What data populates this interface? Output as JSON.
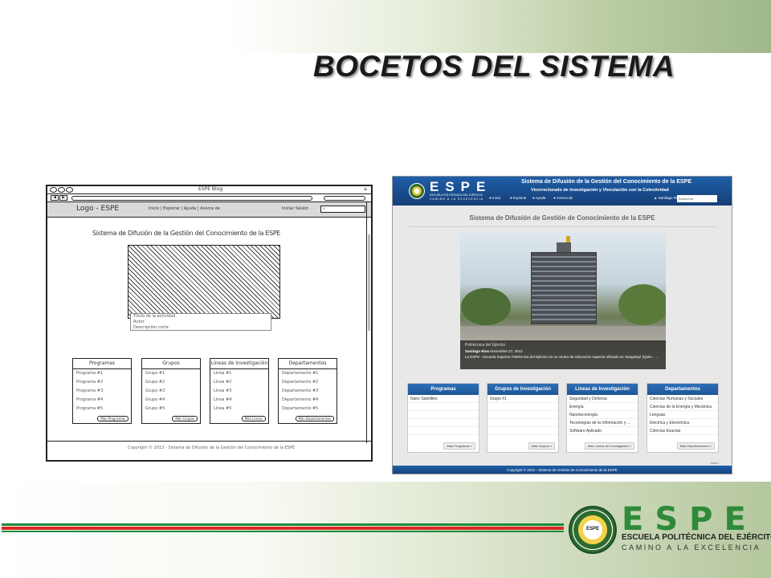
{
  "slide": {
    "title": "BOCETOS DEL SISTEMA",
    "colors": {
      "green": "#1c8a3c",
      "red": "#d62a22",
      "band_green": "#9fb889"
    },
    "logo": {
      "seal_text": "ESPE",
      "word": "ESPE",
      "line1": "ESCUELA POLITÉCNICA DEL EJÉRCITO",
      "line2": "CAMINO A LA EXCELENCIA"
    }
  },
  "sketch": {
    "window_title": "ESPE Blog",
    "close_glyph": "+",
    "logo": "Logo - ESPE",
    "nav": "Inicio | Explorar | Ayuda | Acerca de",
    "login": "Iniciar Sesión",
    "search_icon": "search-icon",
    "heading": "Sistema de Difusión de la Gestión del Conocimiento de la ESPE",
    "caption_lines": [
      "Título de la actividad",
      "Autor",
      "Descripción corta"
    ],
    "panels": [
      {
        "title": "Programas",
        "items": [
          "Programa #1",
          "Programa #2",
          "Programa #3",
          "Programa #4",
          "Programa #5"
        ],
        "more": "Más Programas"
      },
      {
        "title": "Grupos",
        "items": [
          "Grupo #1",
          "Grupo #2",
          "Grupo #3",
          "Grupo #4",
          "Grupo #5"
        ],
        "more": "Más Grupos"
      },
      {
        "title": "Líneas de Investigación",
        "items": [
          "Línea #1",
          "Línea #2",
          "Línea #3",
          "Línea #4",
          "Línea #5"
        ],
        "more": "Más Líneas"
      },
      {
        "title": "Departamentos",
        "items": [
          "Departamento #1",
          "Departamento #2",
          "Departamento #3",
          "Departamento #4",
          "Departamento #5"
        ],
        "more": "Más Departamentos"
      }
    ],
    "footer": "Copyright © 2013 - Sistema de Difusión de la Gestión del Conocimiento de la ESPE"
  },
  "real": {
    "brand": "ESPE",
    "brand_sub1": "ESCUELA POLITÉCNICA DEL EJÉRCITO",
    "brand_sub2": "CAMINO A LA EXCELENCIA",
    "header_title": "Sistema de Difusión de la Gestión del Conocimiento de la ESPE",
    "header_subtitle": "Vicerrectorado de Investigación y Vinculación con la Colectividad",
    "nav": [
      {
        "label": "Inicio",
        "icon": "home-icon"
      },
      {
        "label": "Explorar",
        "icon": "compass-icon"
      },
      {
        "label": "Ayuda",
        "icon": "help-icon"
      },
      {
        "label": "Acerca de",
        "icon": "info-icon"
      }
    ],
    "user": "Santiago Rios",
    "user_icon": "user-icon",
    "search_placeholder": "Búsqueda",
    "page_title": "Sistema de Difusión de Gestión de Conocimiento de la ESPE",
    "photo_caption": {
      "title": "Politécnica del Ejército",
      "author": "Santiago Rios",
      "date": "Noviembre 27, 2012",
      "text": "La ESPE - Escuela Superior Politécnica del Ejército es un centro de educación superior ubicado en Sangolquí (Quito - ..."
    },
    "panels": [
      {
        "title": "Programas",
        "items": [
          "Nano Satellites"
        ],
        "more": "Más Programas »"
      },
      {
        "title": "Grupos de Investigación",
        "items": [
          "Grupo #1"
        ],
        "more": "Más Grupos »"
      },
      {
        "title": "Líneas de Investigación",
        "items": [
          "Seguridad y Defensa",
          "Energía",
          "Nanotecnología",
          "Tecnologías de la Información y ...",
          "Software Aplicado"
        ],
        "more": "Más Líneas de Investigación »"
      },
      {
        "title": "Departamentos",
        "items": [
          "Ciencias Humanas y Sociales",
          "Ciencias de la Energía y Mecánica",
          "Lenguas",
          "Eléctrica y Electrónica",
          "Ciencias Exactas"
        ],
        "more": "Más Departamentos »"
      }
    ],
    "back_to_top": "Inicio ↑",
    "footer": "Copyright © 2012 - Sistema de Gestión de Conocimiento de la ESPE",
    "brand_color": "#1d5697"
  }
}
